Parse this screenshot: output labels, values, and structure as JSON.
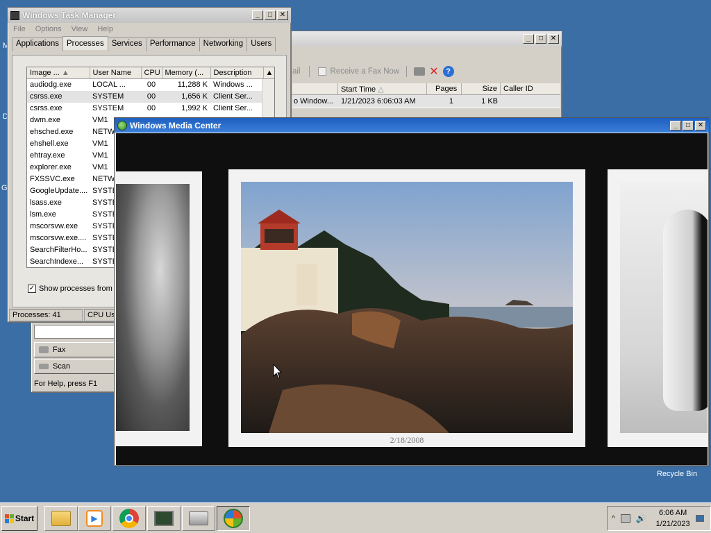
{
  "desktop": {
    "edge_labels": [
      "M",
      "D",
      "G"
    ],
    "recycle_bin_label": "Recycle Bin"
  },
  "task_manager": {
    "title": "Windows Task Manager",
    "menu": [
      "File",
      "Options",
      "View",
      "Help"
    ],
    "tabs": [
      "Applications",
      "Processes",
      "Services",
      "Performance",
      "Networking",
      "Users"
    ],
    "active_tab": "Processes",
    "columns": [
      "Image ...",
      "User Name",
      "CPU",
      "Memory (...",
      "Description"
    ],
    "rows": [
      [
        "audiodg.exe",
        "LOCAL ...",
        "00",
        "11,288 K",
        "Windows ..."
      ],
      [
        "csrss.exe",
        "SYSTEM",
        "00",
        "1,656 K",
        "Client Ser..."
      ],
      [
        "csrss.exe",
        "SYSTEM",
        "00",
        "1,992 K",
        "Client Ser..."
      ],
      [
        "dwm.exe",
        "VM1",
        "",
        "",
        ""
      ],
      [
        "ehsched.exe",
        "NETW",
        "",
        "",
        ""
      ],
      [
        "ehshell.exe",
        "VM1",
        "",
        "",
        ""
      ],
      [
        "ehtray.exe",
        "VM1",
        "",
        "",
        ""
      ],
      [
        "explorer.exe",
        "VM1",
        "",
        "",
        ""
      ],
      [
        "FXSSVC.exe",
        "NETW",
        "",
        "",
        ""
      ],
      [
        "GoogleUpdate....",
        "SYSTE",
        "",
        "",
        ""
      ],
      [
        "lsass.exe",
        "SYSTE",
        "",
        "",
        ""
      ],
      [
        "lsm.exe",
        "SYSTE",
        "",
        "",
        ""
      ],
      [
        "mscorsvw.exe",
        "SYSTE",
        "",
        "",
        ""
      ],
      [
        "mscorsvw.exe....",
        "SYSTE",
        "",
        "",
        ""
      ],
      [
        "SearchFilterHo...",
        "SYSTE",
        "",
        "",
        ""
      ],
      [
        "SearchIndexe...",
        "SYSTE",
        "",
        "",
        ""
      ]
    ],
    "show_all_label": "Show processes from a",
    "show_all_checked": true,
    "status_processes": "Processes: 41",
    "status_cpu": "CPU Usa"
  },
  "fax_window": {
    "toolbar_receive": "Receive a Fax Now",
    "toolbar_partial": "ail",
    "columns": [
      "Start Time",
      "Pages",
      "Size",
      "Caller ID"
    ],
    "row": [
      "o Window...",
      "1/21/2023 6:06:03 AM",
      "1",
      "1 KB"
    ],
    "nav_fax": "Fax",
    "nav_scan": "Scan",
    "status": "For Help, press F1"
  },
  "media_center": {
    "title": "Windows Media Center",
    "photo_date": "2/18/2008"
  },
  "taskbar": {
    "start_label": "Start",
    "time": "6:06 AM",
    "date": "1/21/2023"
  },
  "colors": {
    "desktop": "#3a6ea5",
    "media_bg": "#0f0f0f",
    "selected_row": "#e3e3e3"
  }
}
